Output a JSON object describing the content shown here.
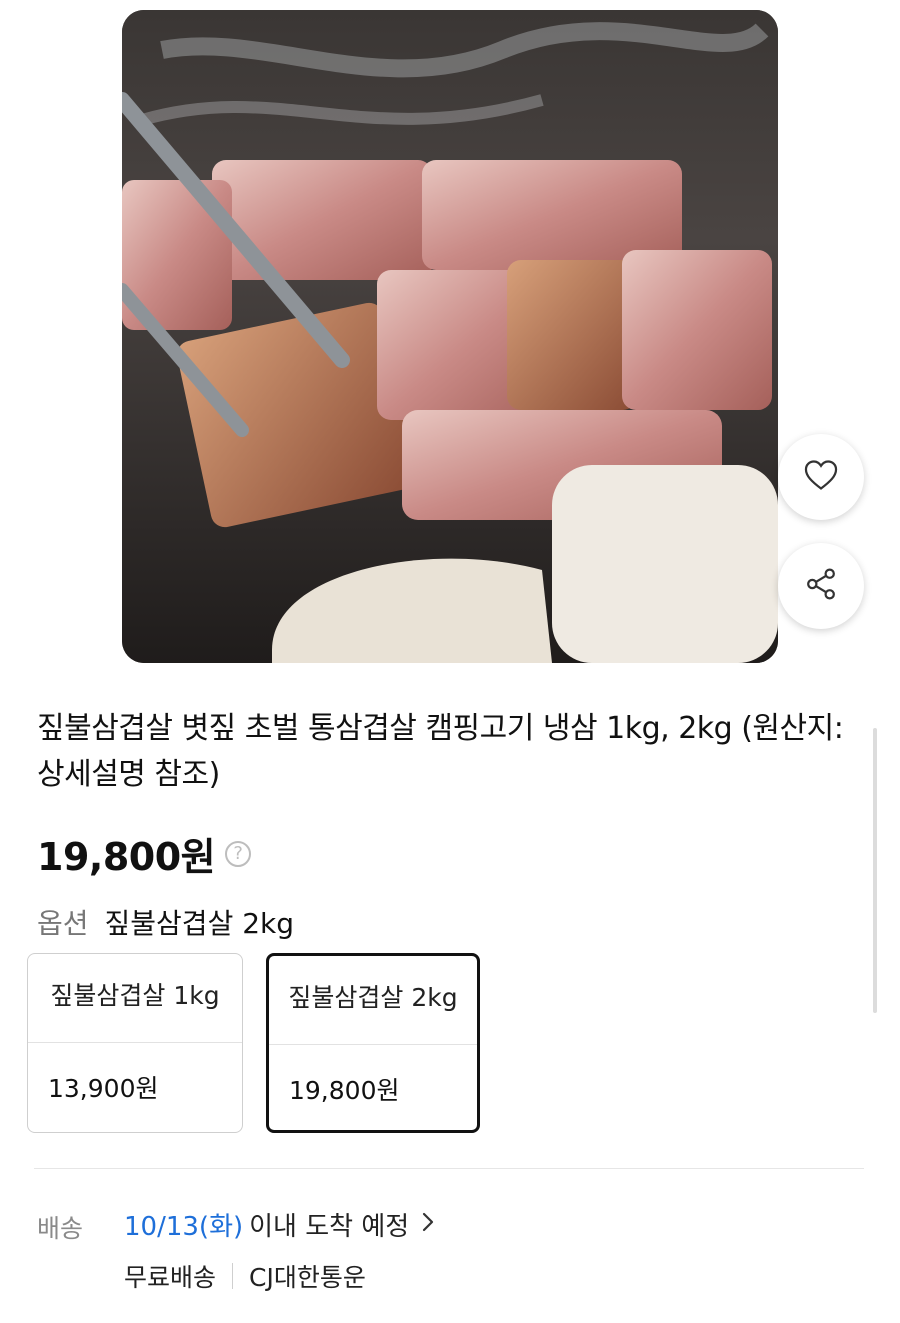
{
  "product": {
    "title": "짚불삼겹살 볏짚 초벌 통삼겹살 캠핑고기 냉삼 1kg, 2kg (원산지: 상세설명 참조)",
    "price": "19,800원"
  },
  "option": {
    "label": "옵션",
    "selected": "짚불삼겹살 2kg",
    "choices": [
      {
        "name": "짚불삼겹살 1kg",
        "price": "13,900원",
        "selected": false
      },
      {
        "name": "짚불삼겹살 2kg",
        "price": "19,800원",
        "selected": true
      }
    ]
  },
  "shipping": {
    "label": "배송",
    "eta_date": "10/13(화)",
    "eta_rest": "이내 도착 예정",
    "fee": "무료배송",
    "carrier": "CJ대한통운"
  },
  "icons": {
    "wishlist": "heart-icon",
    "share": "share-icon",
    "price_help": "question-icon",
    "eta_more": "chevron-right-icon"
  },
  "colors": {
    "accent_blue": "#1e6fd9",
    "selected_border": "#111111",
    "muted_text": "#8a8a8a"
  }
}
